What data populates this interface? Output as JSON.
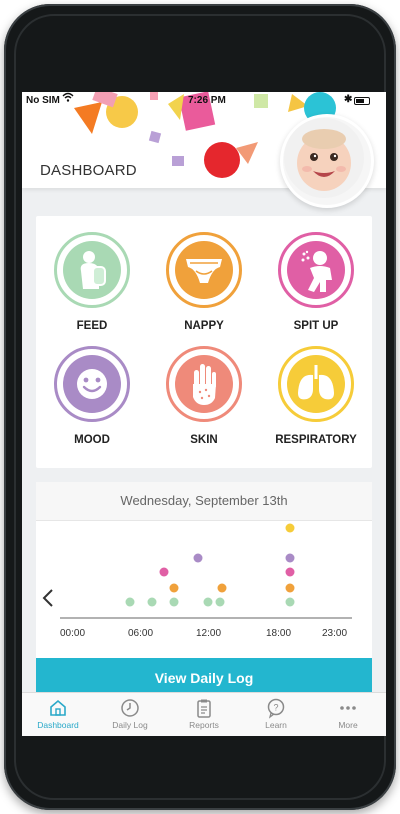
{
  "status_bar": {
    "carrier": "No SIM",
    "time": "7:26 PM"
  },
  "header": {
    "title": "DASHBOARD"
  },
  "categories": [
    {
      "label": "FEED",
      "color": "#a9d9b4",
      "icon": "baby-bottle-icon"
    },
    {
      "label": "NAPPY",
      "color": "#f0a13b",
      "icon": "nappy-icon"
    },
    {
      "label": "SPIT UP",
      "color": "#e05fa5",
      "icon": "spit-up-icon"
    },
    {
      "label": "MOOD",
      "color": "#a98bc6",
      "icon": "smiley-face-icon"
    },
    {
      "label": "SKIN",
      "color": "#ef8a7a",
      "icon": "hand-icon"
    },
    {
      "label": "RESPIRATORY",
      "color": "#f6cc39",
      "icon": "lungs-icon"
    }
  ],
  "daily": {
    "date": "Wednesday, September 13th",
    "time_labels": [
      "00:00",
      "06:00",
      "12:00",
      "18:00",
      "23:00"
    ],
    "view_button": "View Daily Log"
  },
  "tabs": [
    {
      "label": "Dashboard",
      "icon": "home-icon",
      "active": true
    },
    {
      "label": "Daily Log",
      "icon": "clock-icon",
      "active": false
    },
    {
      "label": "Reports",
      "icon": "clipboard-icon",
      "active": false
    },
    {
      "label": "Learn",
      "icon": "question-bubble-icon",
      "active": false
    },
    {
      "label": "More",
      "icon": "more-dots-icon",
      "active": false
    }
  ],
  "colors": {
    "accent": "#23b6cf",
    "tab_active": "#2aa9c9",
    "bezel": "#151819"
  }
}
